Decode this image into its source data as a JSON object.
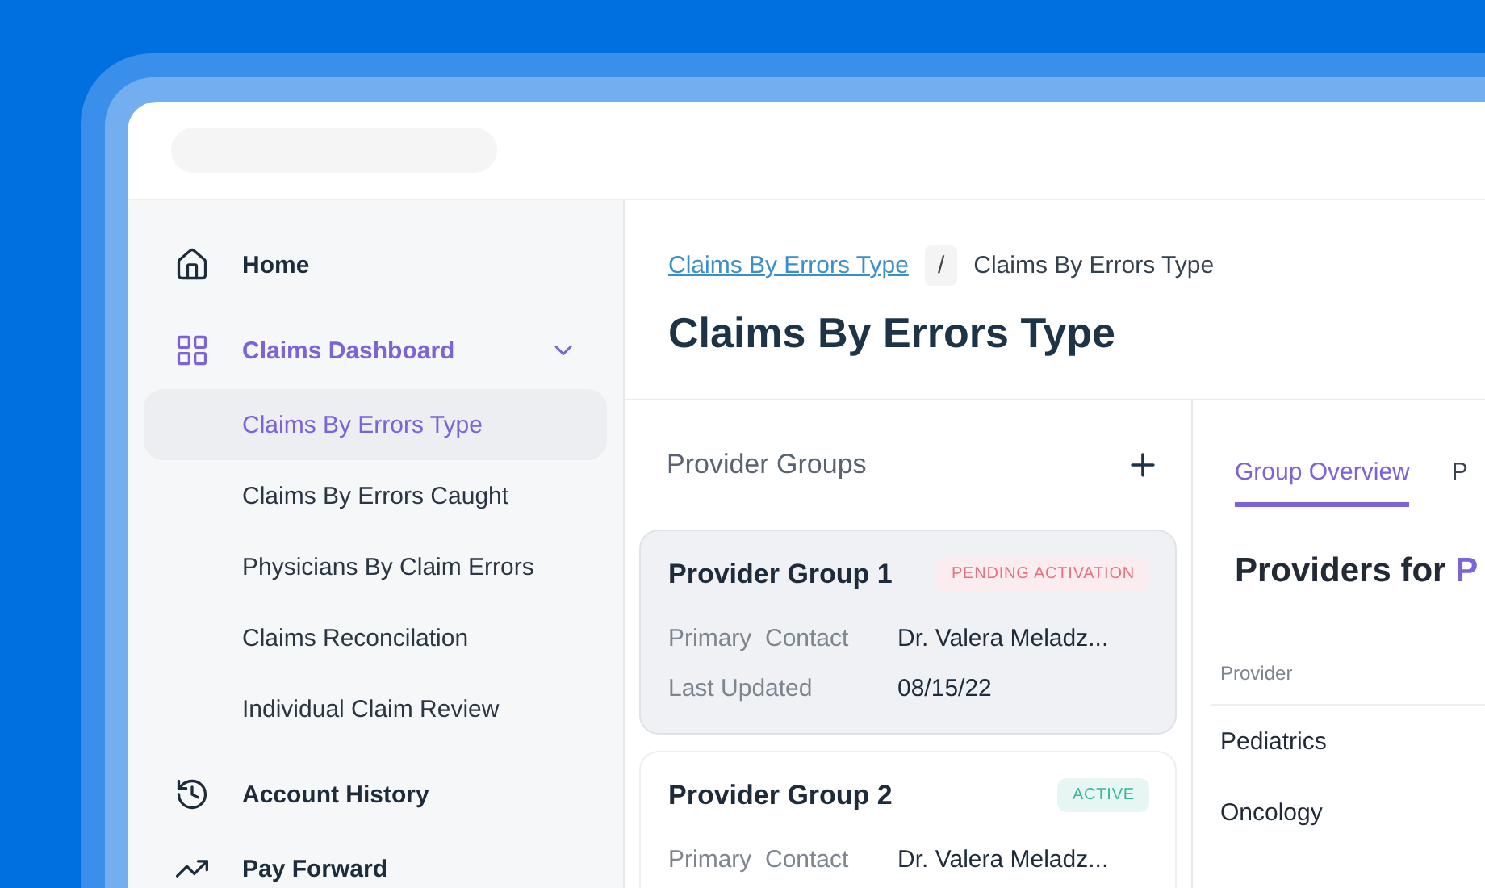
{
  "sidebar": {
    "items": [
      {
        "label": "Home",
        "selected": false
      },
      {
        "label": "Claims Dashboard",
        "selected": true,
        "expanded": true,
        "children": [
          {
            "label": "Claims By Errors Type",
            "selected": true
          },
          {
            "label": "Claims By Errors Caught",
            "selected": false
          },
          {
            "label": "Physicians By Claim Errors",
            "selected": false
          },
          {
            "label": "Claims Reconcilation",
            "selected": false
          },
          {
            "label": "Individual Claim Review",
            "selected": false
          }
        ]
      },
      {
        "label": "Account History",
        "selected": false
      },
      {
        "label": "Pay Forward",
        "selected": false
      }
    ]
  },
  "breadcrumb": [
    {
      "label": "Claims By Errors Type",
      "kind": "link"
    },
    {
      "label": "Claims By Errors Type",
      "kind": "current"
    }
  ],
  "breadcrumb_separator": "/",
  "page_title": "Claims By Errors Type",
  "provider_groups": {
    "title": "Provider Groups",
    "cards": [
      {
        "name": "Provider Group 1",
        "status": "PENDING ACTIVATION",
        "kind": "pending",
        "selected": true,
        "fields": [
          {
            "label": "Primary  Contact",
            "value": "Dr. Valera Meladz..."
          },
          {
            "label": "Last Updated",
            "value": "08/15/22"
          }
        ]
      },
      {
        "name": "Provider Group 2",
        "status": "ACTIVE",
        "kind": "active",
        "selected": false,
        "fields": [
          {
            "label": "Primary  Contact",
            "value": "Dr. Valera Meladz..."
          }
        ]
      }
    ]
  },
  "detail": {
    "tabs": [
      {
        "label": "Group Overview",
        "selected": true
      },
      {
        "label": "P",
        "selected": false
      }
    ],
    "heading": {
      "prefix": "Providers for",
      "highlight": "P"
    },
    "table": {
      "columns": [
        "Provider"
      ],
      "rows": [
        [
          "Pediatrics"
        ],
        [
          "Oncology"
        ]
      ]
    }
  }
}
